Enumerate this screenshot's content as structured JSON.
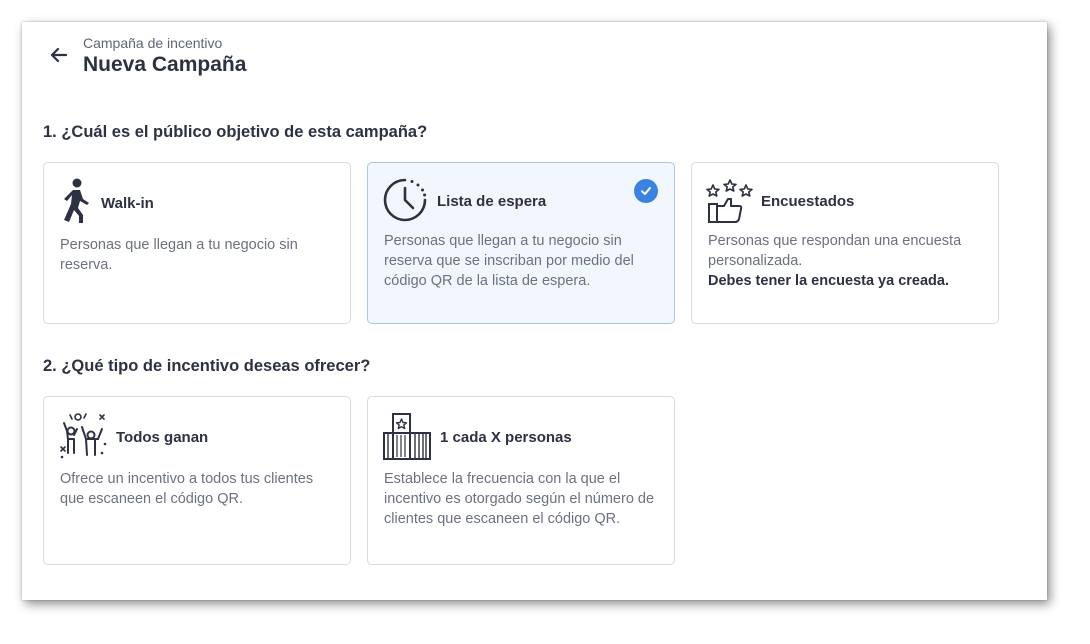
{
  "header": {
    "breadcrumb": "Campaña de incentivo",
    "title": "Nueva Campaña"
  },
  "section1": {
    "title": "1. ¿Cuál es el público objetivo de esta campaña?",
    "cards": [
      {
        "title": "Walk-in",
        "icon": "walking-person-icon",
        "description": "Personas que llegan a tu negocio sin reserva.",
        "selected": false
      },
      {
        "title": "Lista de espera",
        "icon": "clock-icon",
        "description": "Personas que llegan a tu negocio sin reserva que se inscriban por medio del código QR de la lista de espera.",
        "selected": true
      },
      {
        "title": "Encuestados",
        "icon": "stars-thumbs-up-icon",
        "description": "Personas que respondan una encuesta personalizada.",
        "note": "Debes tener la encuesta ya creada.",
        "selected": false
      }
    ]
  },
  "section2": {
    "title": "2. ¿Qué tipo de incentivo deseas ofrecer?",
    "cards": [
      {
        "title": "Todos ganan",
        "icon": "celebrating-people-icon",
        "description": "Ofrece un incentivo a todos tus clientes que escaneen el código QR."
      },
      {
        "title": "1 cada X personas",
        "icon": "queue-star-icon",
        "description": "Establece la frecuencia con la que el incentivo es otorgado según el número de clientes que escaneen el código QR."
      }
    ]
  },
  "colors": {
    "accent": "#3b82e0",
    "selected_bg": "#f2f7fd",
    "text_dark": "#2d3142",
    "text_muted": "#6c7180"
  }
}
